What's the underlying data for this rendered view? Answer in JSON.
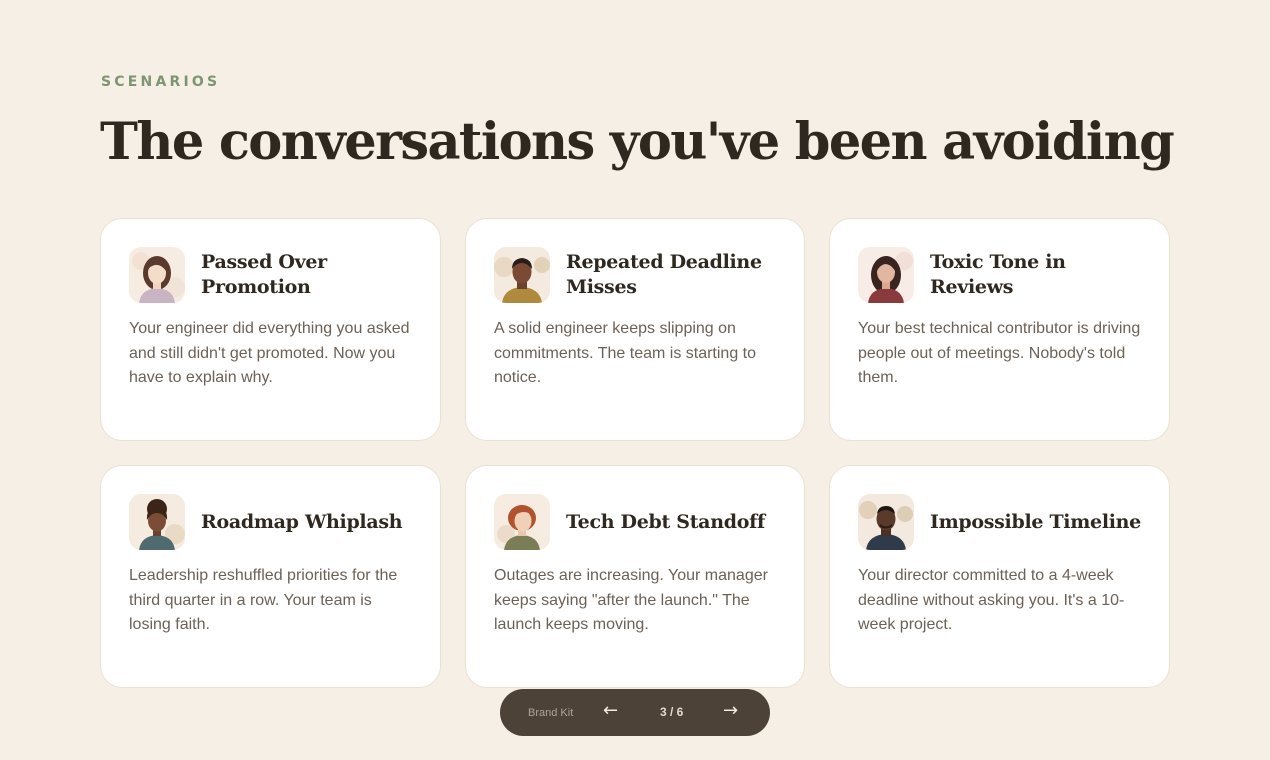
{
  "section": {
    "eyebrow": "SCENARIOS",
    "title": "The conversations you've been avoiding"
  },
  "cards": [
    {
      "title": "Passed Over Promotion",
      "description": "Your engineer did everything you asked and still didn't get promoted. Now you have to explain why.",
      "avatar_icon": "woman-portrait-avatar"
    },
    {
      "title": "Repeated Deadline Misses",
      "description": "A solid engineer keeps slipping on commitments. The team is starting to notice.",
      "avatar_icon": "man-portrait-avatar"
    },
    {
      "title": "Toxic Tone in Reviews",
      "description": "Your best technical contributor is driving people out of meetings. Nobody's told them.",
      "avatar_icon": "woman-portrait-avatar"
    },
    {
      "title": "Roadmap Whiplash",
      "description": "Leadership reshuffled priorities for the third quarter in a row. Your team is losing faith.",
      "avatar_icon": "woman-portrait-avatar"
    },
    {
      "title": "Tech Debt Standoff",
      "description": "Outages are increasing. Your manager keeps saying \"after the launch.\" The launch keeps moving.",
      "avatar_icon": "woman-portrait-avatar"
    },
    {
      "title": "Impossible Timeline",
      "description": "Your director committed to a 4-week deadline without asking you. It's a 10-week project.",
      "avatar_icon": "man-portrait-avatar"
    }
  ],
  "pager": {
    "brand_label": "Brand Kit",
    "prev_icon": "←",
    "next_icon": "→",
    "counter": "3 / 6"
  },
  "colors": {
    "background": "#f6efe5",
    "eyebrow": "#7f9473",
    "heading": "#2f2820",
    "body_text": "#6c6157",
    "card": "#ffffff",
    "pager": "#4c4238"
  }
}
